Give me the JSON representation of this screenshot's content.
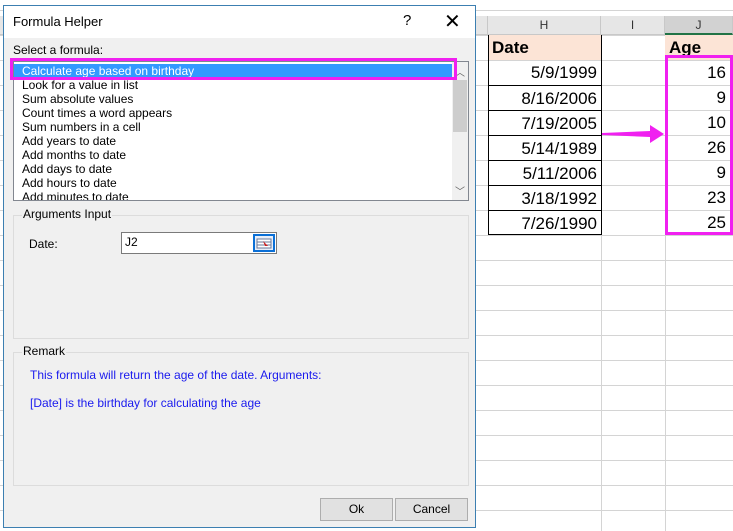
{
  "dialog": {
    "title": "Formula Helper",
    "help": "?",
    "close": "✕",
    "select_label": "Select a formula:",
    "formulas": [
      "Calculate age based on birthday",
      "Look for a value in list",
      "Sum absolute values",
      "Count times a word appears",
      "Sum numbers in a cell",
      "Add years to date",
      "Add months to date",
      "Add days to date",
      "Add hours to date",
      "Add minutes to date"
    ],
    "arguments_title": "Arguments Input",
    "date_label": "Date:",
    "date_value": "J2",
    "remark_title": "Remark",
    "remark_line1": "This formula will return the age of the date. Arguments:",
    "remark_line2": "[Date] is the birthday for calculating the age",
    "ok": "Ok",
    "cancel": "Cancel"
  },
  "sheet": {
    "columns": [
      "H",
      "I",
      "J"
    ],
    "date_header": "Date",
    "age_header": "Age",
    "dates": [
      "5/9/1999",
      "8/16/2006",
      "7/19/2005",
      "5/14/1989",
      "5/11/2006",
      "3/18/1992",
      "7/26/1990"
    ],
    "ages": [
      "16",
      "9",
      "10",
      "26",
      "9",
      "23",
      "25"
    ]
  },
  "colors": {
    "highlight": "#f020f0",
    "selection": "#3399ff",
    "remark": "#1a1aee"
  }
}
